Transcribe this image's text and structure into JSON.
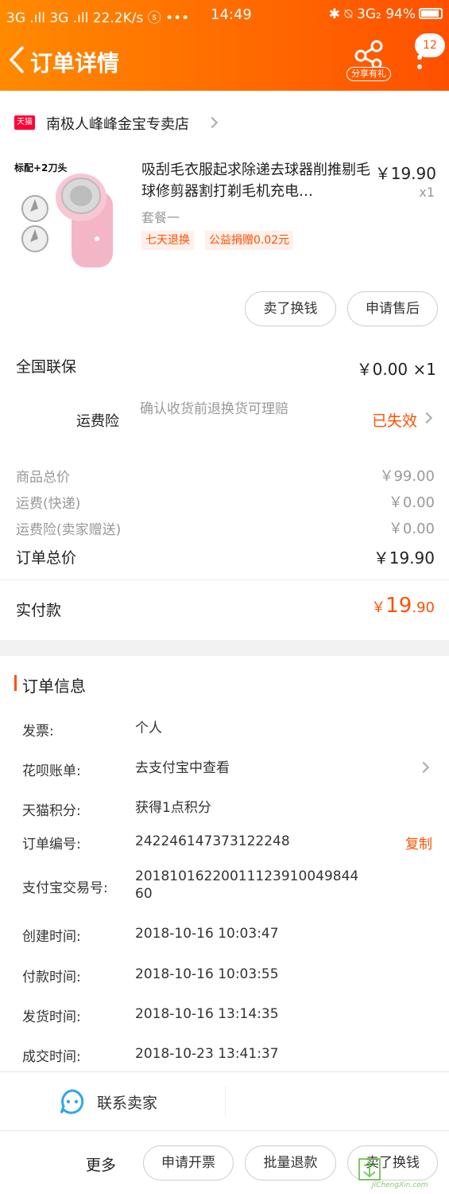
{
  "status": {
    "left": "3G .ıll 3G .ıll 22.2K/s ⓢ •••",
    "time": "14:49",
    "right": "✱ ⍉ 3G₂ 94%"
  },
  "header": {
    "title": "订单详情",
    "share_label": "分享有礼",
    "badge_count": "12"
  },
  "store": {
    "badge": "天猫",
    "name": "南极人峰峰金宝专卖店"
  },
  "product": {
    "image_caption": "标配+2刀头",
    "name": "吸刮毛衣服起求除递去球器削推剔毛球修剪器割打剃毛机充电…",
    "price": "￥19.90",
    "quantity": "x1",
    "sku": "套餐一",
    "tags": [
      "七天退换",
      "公益捐赠0.02元"
    ],
    "buttons": [
      "卖了换钱",
      "申请售后"
    ]
  },
  "guarantee": {
    "label": "全国联保",
    "value": "￥0.00 ×1"
  },
  "shipping_insurance": {
    "label": "运费险",
    "desc": "确认收货前退换货可理赔",
    "status": "已失效"
  },
  "summary": [
    {
      "label": "商品总价",
      "value": "￥99.00"
    },
    {
      "label": "运费(快递)",
      "value": "￥0.00"
    },
    {
      "label": "运费险(卖家赠送)",
      "value": "￥0.00"
    }
  ],
  "order_total": {
    "label": "订单总价",
    "value": "￥19.90"
  },
  "paid": {
    "label": "实付款",
    "symbol": "￥",
    "int": "19",
    "dec": ".90"
  },
  "order_info": {
    "title": "订单信息",
    "rows": [
      {
        "key": "发票:",
        "value": "个人"
      },
      {
        "key": "花呗账单:",
        "value": "去支付宝中查看"
      },
      {
        "key": "天猫积分:",
        "value": "获得1点积分"
      },
      {
        "key": "订单编号:",
        "value": "242246147373122248",
        "action": "复制"
      },
      {
        "key": "支付宝交易号:",
        "value": "20181016220011123910049844 60"
      },
      {
        "key": "创建时间:",
        "value": "2018-10-16 10:03:47"
      },
      {
        "key": "付款时间:",
        "value": "2018-10-16 10:03:55"
      },
      {
        "key": "发货时间:",
        "value": "2018-10-16 13:14:35"
      },
      {
        "key": "成交时间:",
        "value": "2018-10-23 13:41:37"
      }
    ]
  },
  "contact": {
    "label": "联系卖家"
  },
  "footer": {
    "more": "更多",
    "buttons": [
      "申请开票",
      "批量退款",
      "卖了换钱"
    ]
  },
  "watermark": {
    "text": "JiChengXin.com"
  },
  "colors": {
    "brand": "#ff5000",
    "accent": "#ff8a00",
    "text": "#222222",
    "muted": "#999999"
  }
}
